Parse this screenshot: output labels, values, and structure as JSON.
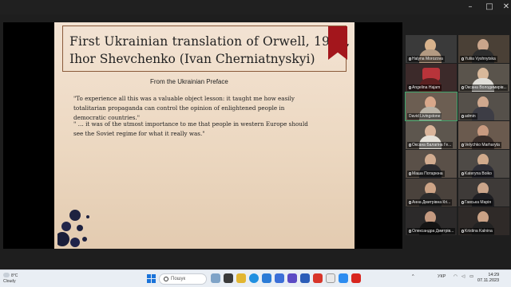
{
  "window": {
    "controls": [
      "–",
      "□",
      "✕"
    ]
  },
  "slide": {
    "title_line1": "First Ukrainian translation of Orwell, 1947,",
    "title_line2": "Ihor Shevchenko (Ivan Cherniatnyskyi)",
    "preface_heading": "From the Ukrainian Preface",
    "quote1": "\"To experience all this was a valuable object lesson: it taught me how easily totalitarian propaganda can control the opinion of enlightened people in democratic countries.\"",
    "quote2": "\" … it was of the utmost importance to me that people in western Europe should see the Soviet regime for what it really was.\""
  },
  "participants": [
    {
      "name": "Halyna Morozova",
      "muted": true
    },
    {
      "name": "Yuliia Vyshnytska",
      "muted": true
    },
    {
      "name": "Angelina Hajam",
      "muted": true
    },
    {
      "name": "Оксана Володимирів...",
      "muted": true
    },
    {
      "name": "David Livingstone",
      "muted": false
    },
    {
      "name": "admin",
      "muted": true
    },
    {
      "name": "Оксана Балагіна Ге...",
      "muted": true
    },
    {
      "name": "Velychko Marharyta",
      "muted": true
    },
    {
      "name": "Маша Потарюна",
      "muted": true
    },
    {
      "name": "Kateryna Boiko",
      "muted": true
    },
    {
      "name": "Анна Дмитрівна Кri...",
      "muted": true
    },
    {
      "name": "Гавська Марія",
      "muted": true
    },
    {
      "name": "Олександра Дмитрів...",
      "muted": true
    },
    {
      "name": "Kristina Kalnina",
      "muted": true
    }
  ],
  "taskbar": {
    "weather_temp": "8°C",
    "weather_text": "Cloudy",
    "search_placeholder": "Пошук",
    "language": "УКР",
    "time": "14:29",
    "date": "07.11.2023"
  }
}
